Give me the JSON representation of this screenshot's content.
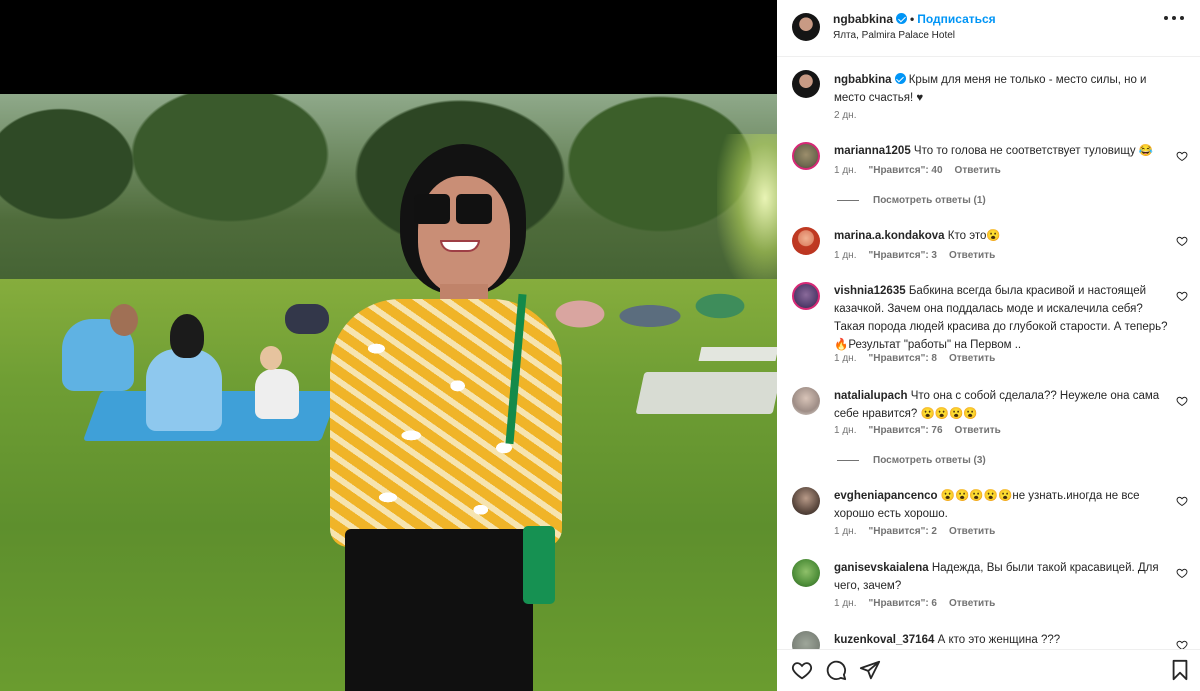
{
  "post": {
    "username": "ngbabkina",
    "follow_label": "Подписаться",
    "location": "Ялта, Palmira Palace Hotel",
    "caption": "Крым для меня не только - место силы, но и место счастья! ♥",
    "caption_time": "2 дн."
  },
  "comments": [
    {
      "username": "marianna1205",
      "text": "Что то голова не соответствует туловищу 😂",
      "time": "1 дн.",
      "likes": "\"Нравится\": 40",
      "reply": "Ответить",
      "view_replies": "Посмотреть ответы (1)"
    },
    {
      "username": "marina.a.kondakova",
      "text": "Кто это😮",
      "time": "1 дн.",
      "likes": "\"Нравится\": 3",
      "reply": "Ответить"
    },
    {
      "username": "vishnia12635",
      "text": "Бабкина всегда была красивой и настоящей казачкой. Зачем она поддалась моде и искалечила себя? Такая порода людей красива до глубокой старости. А теперь? 🔥Результат \"работы\" на Первом ..",
      "time": "1 дн.",
      "likes": "\"Нравится\": 8",
      "reply": "Ответить"
    },
    {
      "username": "natalialupach",
      "text": "Что она с собой сделала?? Неужеле она сама себе нравится? 😮😮😮😮",
      "time": "1 дн.",
      "likes": "\"Нравится\": 76",
      "reply": "Ответить",
      "view_replies": "Посмотреть ответы (3)"
    },
    {
      "username": "evgheniapancenco",
      "text": "😮😮😮😮😮не узнать.иногда не все хорошо есть хорошо.",
      "time": "1 дн.",
      "likes": "\"Нравится\": 2",
      "reply": "Ответить"
    },
    {
      "username": "ganisevskaialena",
      "text": "Надежда, Вы были такой красавицей. Для чего, зачем?",
      "time": "1 дн.",
      "likes": "\"Нравится\": 6",
      "reply": "Ответить"
    },
    {
      "username": "kuzenkoval_37164",
      "text": "А кто это женщина ???"
    }
  ],
  "icons": {
    "like": "heart-icon",
    "comment": "comment-icon",
    "share": "share-icon",
    "save": "bookmark-icon",
    "more": "more-icon"
  },
  "colors": {
    "accent": "#0095f6",
    "text": "#262626",
    "muted": "#737373"
  }
}
